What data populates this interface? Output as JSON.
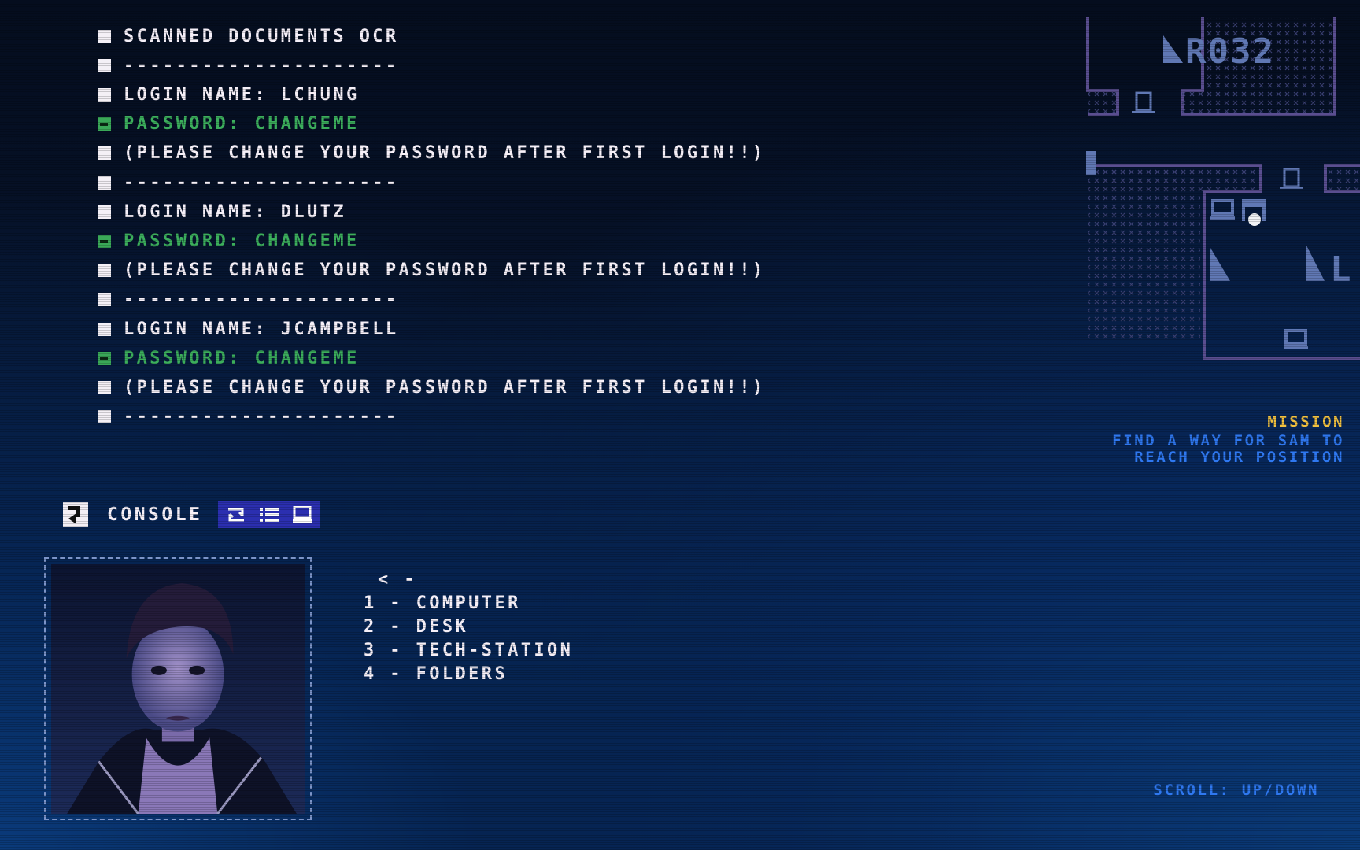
{
  "document": {
    "lines": [
      {
        "type": "text",
        "text": "SCANNED DOCUMENTS OCR"
      },
      {
        "type": "text",
        "text": "---------------------"
      },
      {
        "type": "text",
        "text": "LOGIN NAME: LCHUNG"
      },
      {
        "type": "password",
        "text": "PASSWORD: CHANGEME"
      },
      {
        "type": "text",
        "text": "(PLEASE CHANGE YOUR PASSWORD AFTER FIRST LOGIN!!)"
      },
      {
        "type": "text",
        "text": "---------------------"
      },
      {
        "type": "text",
        "text": "LOGIN NAME: DLUTZ"
      },
      {
        "type": "password",
        "text": "PASSWORD: CHANGEME"
      },
      {
        "type": "text",
        "text": "(PLEASE CHANGE YOUR PASSWORD AFTER FIRST LOGIN!!)"
      },
      {
        "type": "text",
        "text": "---------------------"
      },
      {
        "type": "text",
        "text": "LOGIN NAME: JCAMPBELL"
      },
      {
        "type": "password",
        "text": "PASSWORD: CHANGEME"
      },
      {
        "type": "text",
        "text": "(PLEASE CHANGE YOUR PASSWORD AFTER FIRST LOGIN!!)"
      },
      {
        "type": "text",
        "text": "---------------------"
      }
    ]
  },
  "console": {
    "label": "CONSOLE",
    "icon": "command-return-icon",
    "tabs": [
      {
        "icon": "swap-icon",
        "glyph": "⇄"
      },
      {
        "icon": "list-icon",
        "glyph": "☰"
      },
      {
        "icon": "computer-icon",
        "glyph": "🖳"
      }
    ]
  },
  "portrait": {
    "subject": "operator portrait"
  },
  "menu": {
    "back": "< -",
    "items": [
      {
        "key": "1",
        "label": "1 - COMPUTER"
      },
      {
        "key": "2",
        "label": "2 - DESK"
      },
      {
        "key": "3",
        "label": "3 - TECH-STATION"
      },
      {
        "key": "4",
        "label": "4 - FOLDERS"
      }
    ]
  },
  "map": {
    "room_label": "R032",
    "partial_label": "L"
  },
  "mission": {
    "title": "MISSION",
    "line1": "FIND A WAY FOR SAM TO",
    "line2": "REACH YOUR POSITION"
  },
  "hint": {
    "scroll": "SCROLL: UP/DOWN"
  },
  "colors": {
    "text": "#f6f0f8",
    "password": "#3cae5c",
    "mission_title": "#f0c040",
    "mission_text": "#2f78f0",
    "tabbar": "#2b2fb0",
    "map": "#5a62a0"
  }
}
